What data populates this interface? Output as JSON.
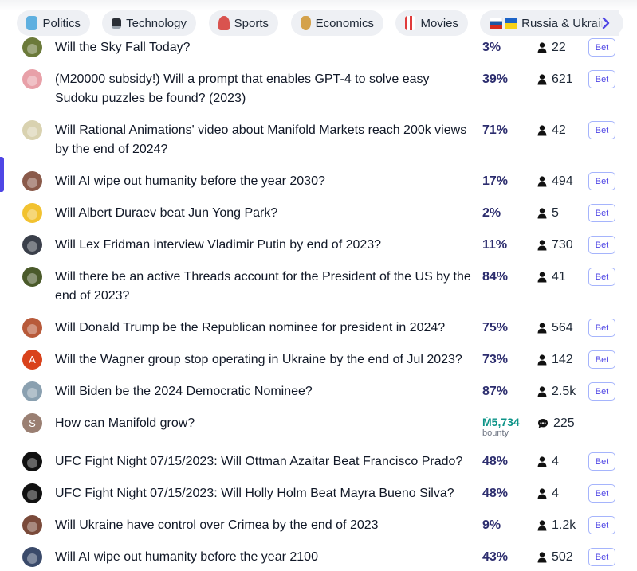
{
  "categories": [
    {
      "label": "Politics",
      "icon": "globe-icon"
    },
    {
      "label": "Technology",
      "icon": "laptop-icon"
    },
    {
      "label": "Sports",
      "icon": "stadium-icon"
    },
    {
      "label": "Economics",
      "icon": "money-bag-icon"
    },
    {
      "label": "Movies",
      "icon": "popcorn-icon"
    },
    {
      "label": "Russia & Ukraine",
      "icon": "russia-ukraine-flags-icon"
    }
  ],
  "bet_label": "Bet",
  "bounty_label": "bounty",
  "markets": [
    {
      "title": "Will the Sky Fall Today?",
      "prob": "3%",
      "traders": "22",
      "avatar_color": "#6b7a3a",
      "avatar_letter": ""
    },
    {
      "title": "(M20000 subsidy!) Will a prompt that enables GPT-4 to solve easy Sudoku puzzles be found? (2023)",
      "prob": "39%",
      "traders": "621",
      "avatar_color": "#e8a0a8",
      "avatar_letter": ""
    },
    {
      "title": "Will Rational Animations' video about Manifold Markets reach 200k views by the end of 2024?",
      "prob": "71%",
      "traders": "42",
      "avatar_color": "#d9d2b0",
      "avatar_letter": ""
    },
    {
      "title": "Will AI wipe out humanity before the year 2030?",
      "prob": "17%",
      "traders": "494",
      "avatar_color": "#8a5a4a",
      "avatar_letter": ""
    },
    {
      "title": "Will Albert Duraev beat Jun Yong Park?",
      "prob": "2%",
      "traders": "5",
      "avatar_color": "#f2c230",
      "avatar_letter": ""
    },
    {
      "title": "Will Lex Fridman interview Vladimir Putin by end of 2023?",
      "prob": "11%",
      "traders": "730",
      "avatar_color": "#3a3f4a",
      "avatar_letter": ""
    },
    {
      "title": "Will there be an active Threads account for the President of the US by the end of 2023?",
      "prob": "84%",
      "traders": "41",
      "avatar_color": "#4a5a2a",
      "avatar_letter": ""
    },
    {
      "title": "Will Donald Trump be the Republican nominee for president in 2024?",
      "prob": "75%",
      "traders": "564",
      "avatar_color": "#b85a3a",
      "avatar_letter": ""
    },
    {
      "title": "Will the Wagner group stop operating in Ukraine by the end of Jul 2023?",
      "prob": "73%",
      "traders": "142",
      "avatar_color": "#d9421b",
      "avatar_letter": "A"
    },
    {
      "title": "Will Biden be the 2024 Democratic Nominee?",
      "prob": "87%",
      "traders": "2.5k",
      "avatar_color": "#8aa0b0",
      "avatar_letter": ""
    },
    {
      "title": "How can Manifold grow?",
      "bounty": "Ṁ5,734",
      "comments": "225",
      "avatar_color": "#9a7f72",
      "avatar_letter": "S"
    },
    {
      "title": "UFC Fight Night 07/15/2023: Will Ottman Azaitar Beat Francisco Prado?",
      "prob": "48%",
      "traders": "4",
      "avatar_color": "#111111",
      "avatar_letter": ""
    },
    {
      "title": "UFC Fight Night 07/15/2023: Will Holly Holm Beat Mayra Bueno Silva?",
      "prob": "48%",
      "traders": "4",
      "avatar_color": "#111111",
      "avatar_letter": ""
    },
    {
      "title": "Will Ukraine have control over Crimea by the end of 2023",
      "prob": "9%",
      "traders": "1.2k",
      "avatar_color": "#7a4a3a",
      "avatar_letter": ""
    },
    {
      "title": "Will AI wipe out humanity before the year 2100",
      "prob": "43%",
      "traders": "502",
      "avatar_color": "#3a4a6a",
      "avatar_letter": ""
    }
  ]
}
